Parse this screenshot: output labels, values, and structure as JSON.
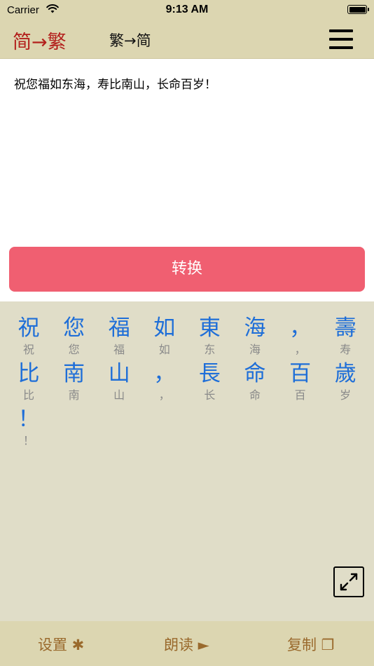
{
  "status": {
    "carrier": "Carrier",
    "time": "9:13 AM"
  },
  "nav": {
    "primary_tab": "简→繁",
    "secondary_tab": "繁→简",
    "menu_icon": "hamburger-menu-icon"
  },
  "editor": {
    "text": "祝您福如东海，寿比南山，长命百岁！"
  },
  "convert_label": "转换",
  "results": [
    {
      "trad": "祝",
      "simp": "祝"
    },
    {
      "trad": "您",
      "simp": "您"
    },
    {
      "trad": "福",
      "simp": "福"
    },
    {
      "trad": "如",
      "simp": "如"
    },
    {
      "trad": "東",
      "simp": "东"
    },
    {
      "trad": "海",
      "simp": "海"
    },
    {
      "trad": "，",
      "simp": "，"
    },
    {
      "trad": "壽",
      "simp": "寿"
    },
    {
      "trad": "比",
      "simp": "比"
    },
    {
      "trad": "南",
      "simp": "南"
    },
    {
      "trad": "山",
      "simp": "山"
    },
    {
      "trad": "，",
      "simp": "，"
    },
    {
      "trad": "長",
      "simp": "长"
    },
    {
      "trad": "命",
      "simp": "命"
    },
    {
      "trad": "百",
      "simp": "百"
    },
    {
      "trad": "歲",
      "simp": "岁"
    },
    {
      "trad": "！",
      "simp": "！"
    }
  ],
  "toolbar": {
    "settings_label": "设置 ✱",
    "read_label": "朗读 ►",
    "copy_label": "复制 ❐"
  },
  "colors": {
    "bar_bg": "#dcd6b1",
    "panel_bg": "#e0ddc8",
    "accent_red": "#b3201c",
    "button_pink": "#f05f71",
    "trad_blue": "#1e6ed8",
    "toolbar_text": "#9a6a2d"
  }
}
